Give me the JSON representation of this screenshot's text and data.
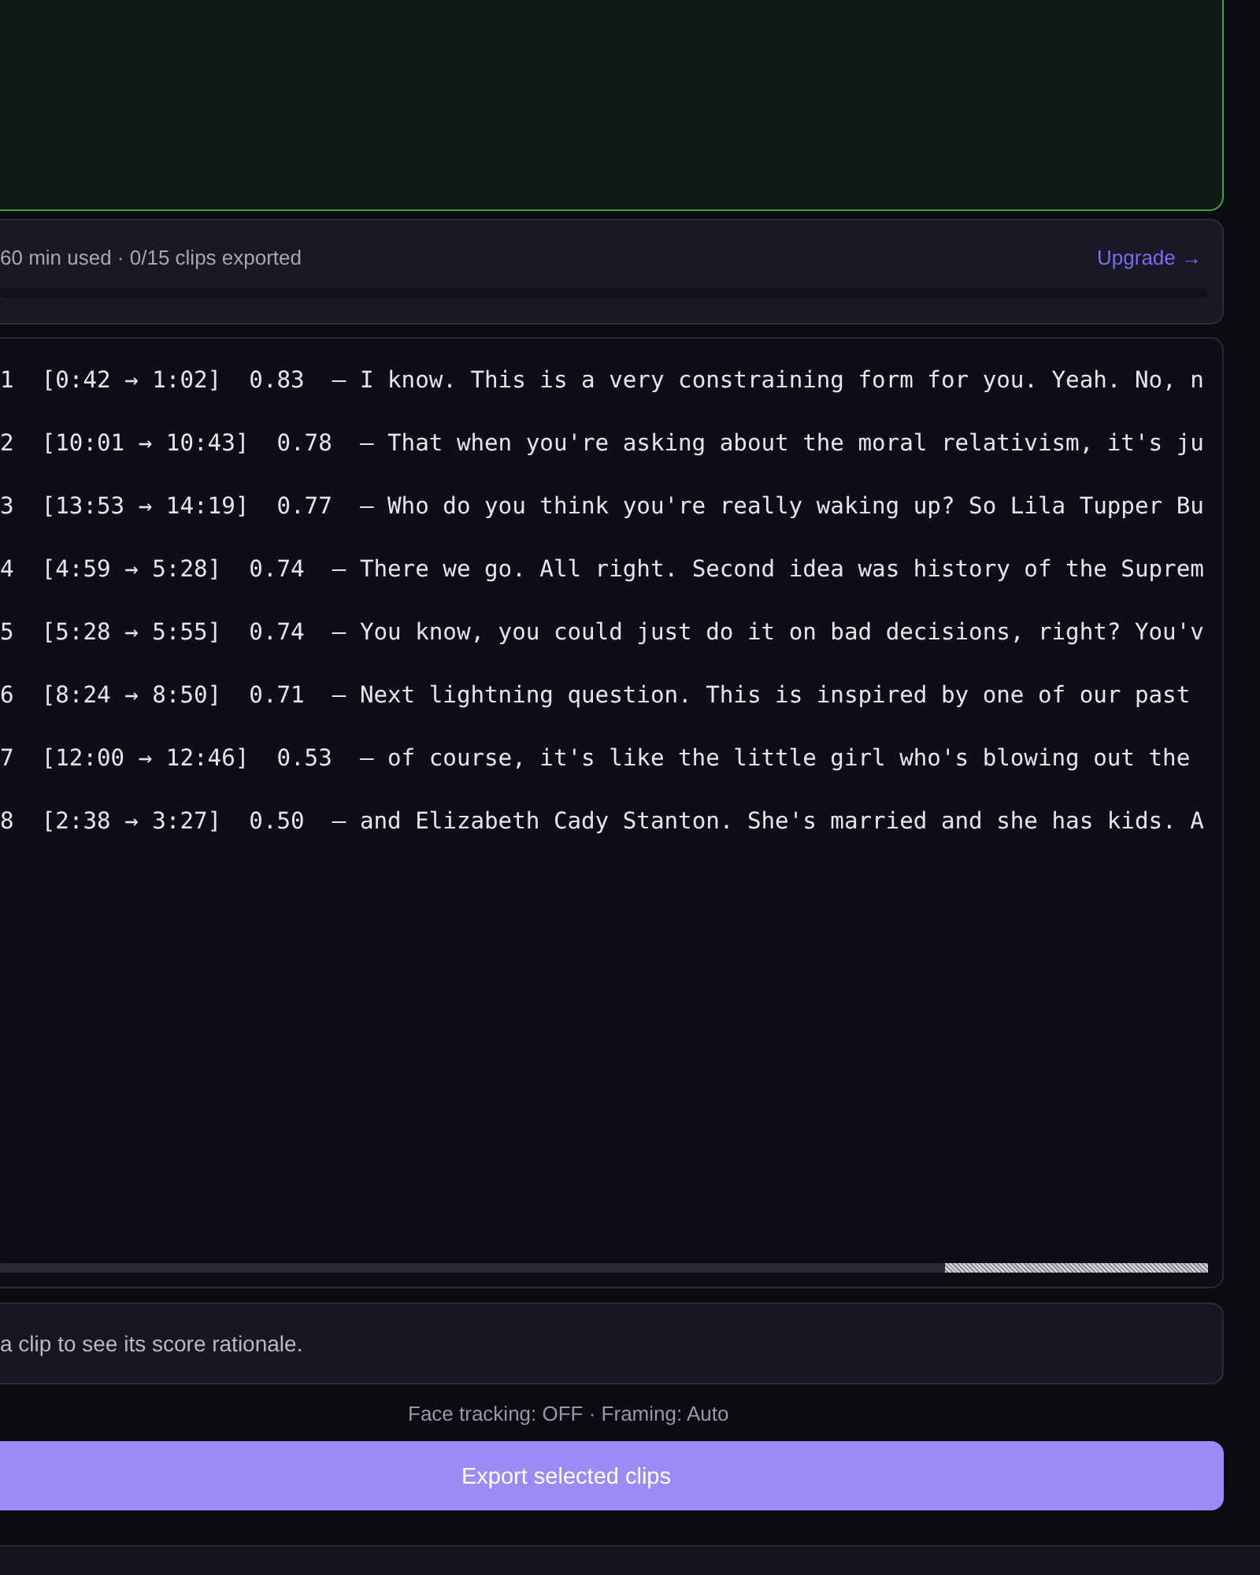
{
  "usage": {
    "summary": "60 min used · 0/15 clips exported",
    "upgrade_link": "Upgrade →"
  },
  "clips": [
    {
      "index": "1",
      "range": "[0:42 → 1:02]",
      "score": "0.83",
      "transcript": "— I know. This is a very constraining form for you. Yeah. No, n"
    },
    {
      "index": "2",
      "range": "[10:01 → 10:43]",
      "score": "0.78",
      "transcript": "— That when you're asking about the moral relativism, it's ju"
    },
    {
      "index": "3",
      "range": "[13:53 → 14:19]",
      "score": "0.77",
      "transcript": "— Who do you think you're really waking up? So Lila Tupper Bu"
    },
    {
      "index": "4",
      "range": "[4:59 → 5:28]",
      "score": "0.74",
      "transcript": "— There we go. All right. Second idea was history of the Suprem"
    },
    {
      "index": "5",
      "range": "[5:28 → 5:55]",
      "score": "0.74",
      "transcript": "— You know, you could just do it on bad decisions, right? You'v"
    },
    {
      "index": "6",
      "range": "[8:24 → 8:50]",
      "score": "0.71",
      "transcript": "— Next lightning question. This is inspired by one of our past"
    },
    {
      "index": "7",
      "range": "[12:00 → 12:46]",
      "score": "0.53",
      "transcript": "— of course, it's like the little girl who's blowing out the"
    },
    {
      "index": "8",
      "range": "[2:38 → 3:27]",
      "score": "0.50",
      "transcript": "— and Elizabeth Cady Stanton. She's married and she has kids. A"
    }
  ],
  "rationale": {
    "hint": "a clip to see its score rationale."
  },
  "export": {
    "settings": "Face tracking: OFF · Framing: Auto",
    "button": "Export selected clips"
  }
}
